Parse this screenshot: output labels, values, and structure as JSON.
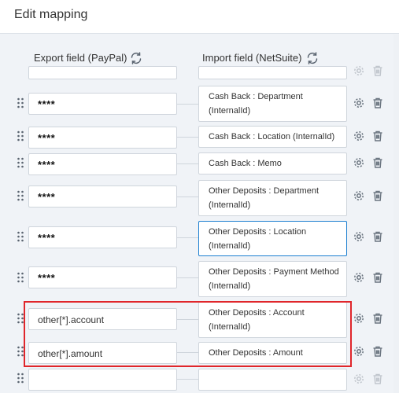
{
  "dialog": {
    "title": "Edit mapping"
  },
  "columns": {
    "export_label": "Export field (PayPal)",
    "import_label": "Import field (NetSuite)"
  },
  "rows": [
    {
      "export": "",
      "import": ""
    },
    {
      "export": "****",
      "import": "Cash Back : Department (InternalId)"
    },
    {
      "export": "****",
      "import": "Cash Back : Location (InternalId)"
    },
    {
      "export": "****",
      "import": "Cash Back : Memo"
    },
    {
      "export": "****",
      "import": "Other Deposits : Department (InternalId)"
    },
    {
      "export": "****",
      "import": "Other Deposits : Location (InternalId)"
    },
    {
      "export": "****",
      "import": "Other Deposits : Payment Method (InternalId)"
    },
    {
      "export": "other[*].account",
      "import": "Other Deposits : Account (InternalId)"
    },
    {
      "export": "other[*].amount",
      "import": "Other Deposits : Amount"
    },
    {
      "export": "",
      "import": ""
    }
  ],
  "colors": {
    "accent": "#1c7fd0",
    "highlight": "#e0262b"
  }
}
